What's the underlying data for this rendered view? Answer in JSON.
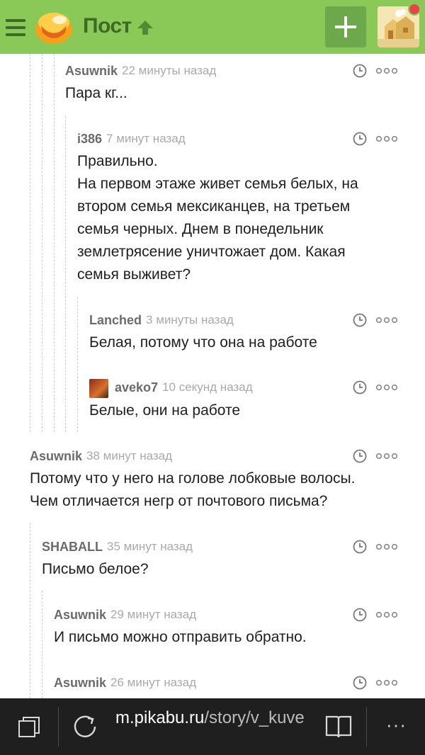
{
  "header": {
    "title": "Пост",
    "colors": {
      "bar": "#8ac858",
      "title": "#3d6b26",
      "add_button": "#6ea84c",
      "badge": "#e64646"
    },
    "icons": [
      "menu-icon",
      "pikabu-logo",
      "up-arrow-icon",
      "plus-icon",
      "user-avatar",
      "notification-dot"
    ]
  },
  "comments": [
    {
      "author": "Asuwnik",
      "time": "22 минуты назад",
      "lines": [
        "Пара кг..."
      ]
    },
    {
      "author": "i386",
      "time": "7 минут назад",
      "lines": [
        "Правильно.",
        "На первом этаже живет семья белых, на",
        "втором семья мексиканцев, на третьем",
        "семья черных. Днем в понедельник",
        "землетрясение уничтожает дом. Какая",
        "семья выживет?"
      ]
    },
    {
      "author": "Lanched",
      "time": "3 минуты назад",
      "lines": [
        "Белая, потому что она на работе"
      ]
    },
    {
      "author": "aveko7",
      "time": "10 секунд назад",
      "lines": [
        "Белые, они на работе"
      ]
    },
    {
      "author": "Asuwnik",
      "time": "38 минут назад",
      "lines": [
        "Потому что у него на голове лобковые волосы.",
        "Чем отличается негр от почтового письма?"
      ]
    },
    {
      "author": "SHABALL",
      "time": "35 минут назад",
      "lines": [
        "Письмо белое?"
      ]
    },
    {
      "author": "Asuwnik",
      "time": "29 минут назад",
      "lines": [
        "И письмо можно отправить обратно."
      ]
    },
    {
      "author": "Asuwnik",
      "time": "26 минут назад",
      "lines": []
    }
  ],
  "browser": {
    "url_host": "m.pikabu.ru",
    "url_path": "/story/v_kuve",
    "more_label": "···",
    "icons": [
      "tabs-icon",
      "refresh-icon",
      "reading-view-icon",
      "more-icon"
    ]
  }
}
